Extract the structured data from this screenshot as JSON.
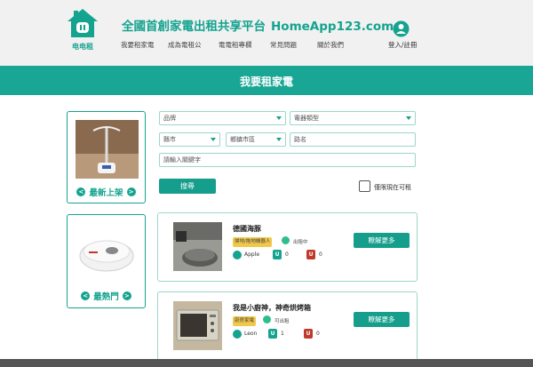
{
  "header": {
    "logo_text": "电电租",
    "site_title": "全國首創家電出租共享平台",
    "site_domain": "HomeApp123.com",
    "nav": [
      "我要租家電",
      "成為電租公",
      "電電租專欄",
      "常見問題",
      "關於我們"
    ],
    "login_label": "登入/註冊"
  },
  "banner": {
    "title": "我要租家電"
  },
  "sidebar": {
    "newest_label": "最新上架",
    "popular_label": "最熱門"
  },
  "filters": {
    "brand": "品牌",
    "appliance_type": "電器類型",
    "city": "縣市",
    "district": "鄉鎮市區",
    "road": "路名",
    "keyword": "請輸入關鍵字",
    "search_label": "搜尋",
    "available_only_label": "僅限現在可租"
  },
  "listings": [
    {
      "name": "德國海豚",
      "category": "掃地/拖地機器人",
      "status": "出租中",
      "owner": "Apple",
      "likes": "0",
      "dislikes": "0",
      "more_label": "瞭解更多"
    },
    {
      "name": "我是小廚神，神奇烘烤箱",
      "category": "廚房家電",
      "status": "可出租",
      "owner": "Leon",
      "likes": "1",
      "dislikes": "0",
      "more_label": "瞭解更多"
    }
  ],
  "colors": {
    "brand": "#14a38f",
    "banner": "#1aa695",
    "header_bg": "#f1f1f1"
  },
  "icons": [
    "house-logo-icon",
    "user-icon",
    "arrow-left-icon",
    "arrow-right-icon",
    "dropdown-caret-icon",
    "owner-icon",
    "like-icon",
    "dislike-icon"
  ]
}
